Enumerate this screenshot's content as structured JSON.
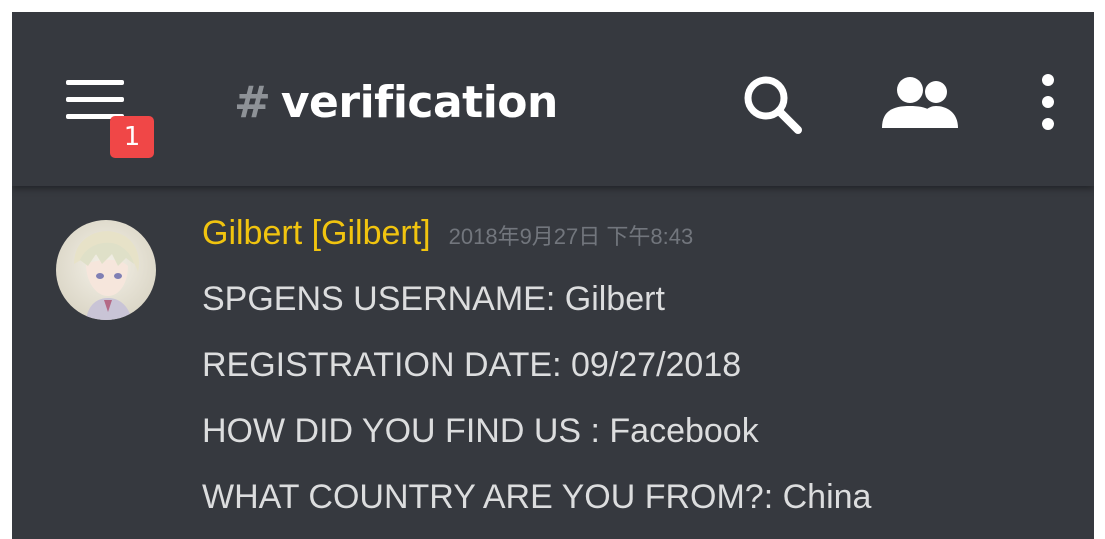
{
  "header": {
    "menu_icon": "hamburger-menu-icon",
    "notification_badge": "1",
    "channel_hash": "#",
    "channel_name": "verification",
    "search_icon": "search-icon",
    "members_icon": "members-icon",
    "more_icon": "more-vertical-icon"
  },
  "message": {
    "author": "Gilbert [Gilbert]",
    "author_color": "#f1c40f",
    "timestamp": "2018年9月27日 下午8:43",
    "lines": [
      "SPGENS USERNAME: Gilbert",
      "REGISTRATION DATE:  09/27/2018",
      "HOW DID YOU FIND US : Facebook",
      "WHAT COUNTRY ARE YOU FROM?: China"
    ]
  },
  "colors": {
    "background": "#36393f",
    "badge": "#f04747",
    "channel_hash": "#8e9297",
    "text": "#dcddde",
    "timestamp": "#72767d"
  }
}
